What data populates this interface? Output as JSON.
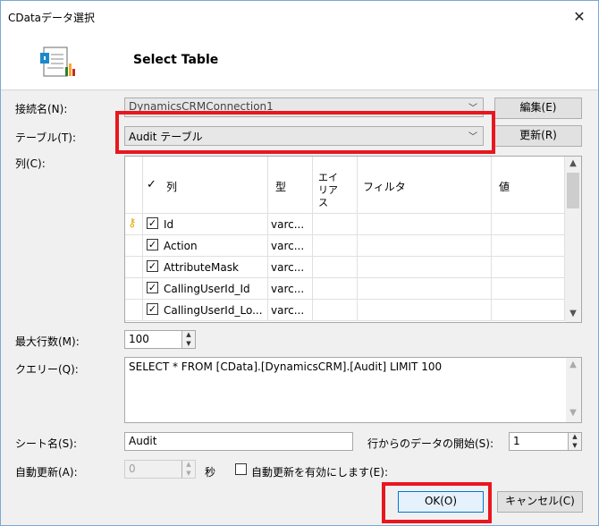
{
  "window": {
    "title": "CDataデータ選択",
    "close_glyph": "✕"
  },
  "header": {
    "title": "Select Table",
    "icon": "document-table-icon"
  },
  "connection": {
    "label": "接続名(N):",
    "value": "DynamicsCRMConnection1",
    "edit_button": "編集(E)"
  },
  "table": {
    "label": "テーブル(T):",
    "value": "Audit テーブル",
    "refresh_button": "更新(R)"
  },
  "columns": {
    "label": "列(C):",
    "headers": {
      "select_all_check": "✓",
      "column": "列",
      "type": "型",
      "alias": "エイリアス",
      "filter": "フィルタ",
      "value": "値"
    },
    "rows": [
      {
        "key": true,
        "checked": "✓",
        "name": "Id",
        "type": "varc..."
      },
      {
        "key": false,
        "checked": "✓",
        "name": "Action",
        "type": "varc..."
      },
      {
        "key": false,
        "checked": "✓",
        "name": "AttributeMask",
        "type": "varc..."
      },
      {
        "key": false,
        "checked": "✓",
        "name": "CallingUserId_Id",
        "type": "varc..."
      },
      {
        "key": false,
        "checked": "✓",
        "name": "CallingUserId_Lo...",
        "type": "varc..."
      }
    ]
  },
  "max_rows": {
    "label": "最大行数(M):",
    "value": "100"
  },
  "query": {
    "label": "クエリー(Q):",
    "value": "SELECT * FROM [CData].[DynamicsCRM].[Audit] LIMIT 100"
  },
  "sheet": {
    "label": "シート名(S):",
    "value": "Audit",
    "start_row_label": "行からのデータの開始(S):",
    "start_row_value": "1"
  },
  "auto_refresh": {
    "label": "自動更新(A):",
    "value": "0",
    "unit": "秒",
    "enable_label": "自動更新を有効にします(E):",
    "enabled": false
  },
  "buttons": {
    "ok": "OK(O)",
    "cancel": "キャンセル(C)"
  },
  "colors": {
    "highlight": "#e8171f",
    "key_icon": "#e0a800"
  }
}
